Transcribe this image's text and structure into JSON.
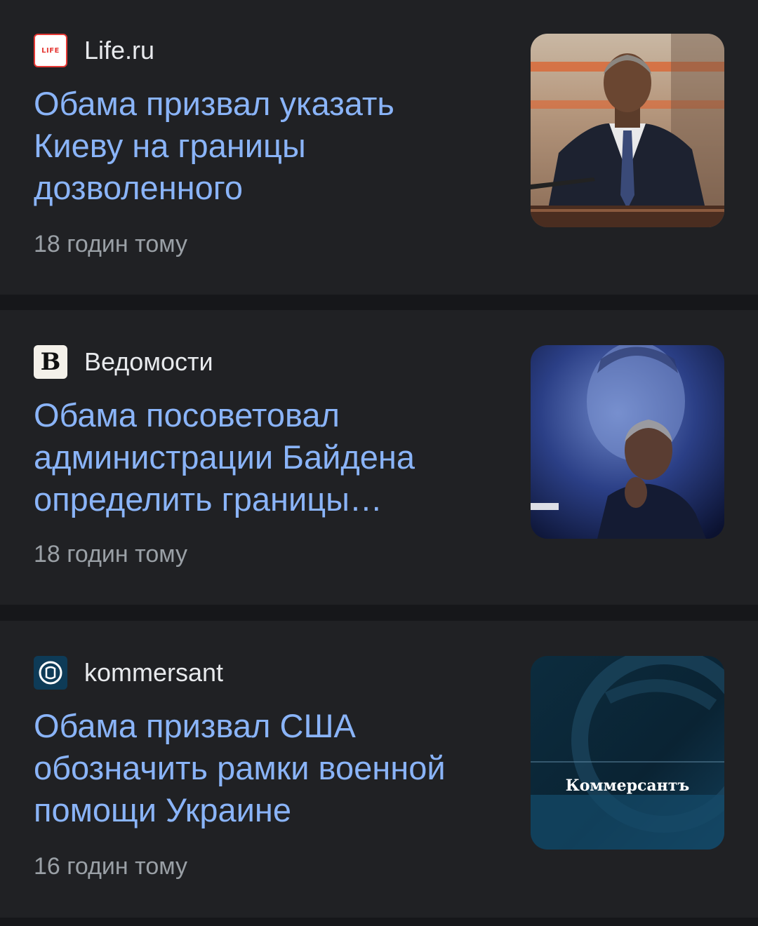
{
  "articles": [
    {
      "source": "Life.ru",
      "favicon_text": "LIFE",
      "favicon_icon": "life-ru-logo-icon",
      "headline": "Обама призвал указать Киеву на границы дозволенного",
      "time": "18 годин тому",
      "thumbnail": "obama-at-podium-photo"
    },
    {
      "source": "Ведомости",
      "favicon_text": "В",
      "favicon_icon": "vedomosti-logo-icon",
      "headline": "Обама посоветовал администрации Байдена определить границы…",
      "time": "18 годин тому",
      "thumbnail": "obama-on-stage-blue-photo"
    },
    {
      "source": "kommersant",
      "favicon_icon": "kommersant-logo-icon",
      "headline": "Обама призвал США обозначить рамки военной помощи Украине",
      "time": "16 годин тому",
      "thumbnail": "kommersant-branded-image",
      "thumbnail_text": "Коммерсантъ"
    }
  ],
  "colors": {
    "background": "#16171a",
    "card": "#202124",
    "headline": "#8ab4f8",
    "source": "#e8eaed",
    "time": "#9aa0a6"
  }
}
